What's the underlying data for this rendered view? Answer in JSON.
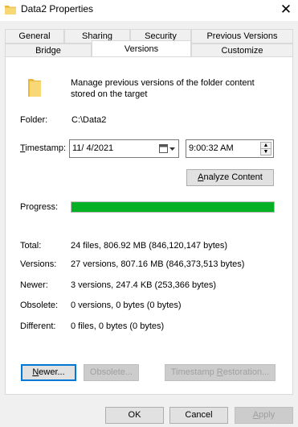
{
  "window": {
    "title": "Data2 Properties",
    "close_glyph": "✕"
  },
  "tabs_row_top": [
    {
      "label": "General"
    },
    {
      "label": "Sharing"
    },
    {
      "label": "Security"
    },
    {
      "label": "Previous Versions"
    }
  ],
  "tabs_row_bottom": [
    {
      "label": "Bridge"
    },
    {
      "label": "Versions",
      "active": true
    },
    {
      "label": "Customize"
    }
  ],
  "description": "Manage previous versions of the folder content stored on the target",
  "folder": {
    "label": "Folder:",
    "value": "C:\\Data2"
  },
  "timestamp": {
    "label_pre": "",
    "label_underline": "T",
    "label_post": "imestamp:",
    "date": "11/  4/2021",
    "time": "9:00:32 AM"
  },
  "analyze_button": {
    "underline": "A",
    "rest": "nalyze Content"
  },
  "progress": {
    "label": "Progress:",
    "fraction": 1.0
  },
  "stats": [
    {
      "label": "Total:",
      "value": "24 files, 806.92 MB (846,120,147 bytes)"
    },
    {
      "label": "Versions:",
      "value": "27 versions, 807.16 MB (846,373,513 bytes)"
    },
    {
      "label": "Newer:",
      "value": "3 versions, 247.4 KB (253,366 bytes)"
    },
    {
      "label": "Obsolete:",
      "value": "0 versions, 0 bytes (0 bytes)"
    },
    {
      "label": "Different:",
      "value": "0 files, 0 bytes (0 bytes)"
    }
  ],
  "actions": {
    "newer": {
      "underline": "N",
      "rest": "ewer..."
    },
    "obsolete": {
      "label": "Obsolete..."
    },
    "restore": {
      "pre": "Timestamp ",
      "underline": "R",
      "rest": "estoration..."
    }
  },
  "dialog_buttons": {
    "ok": "OK",
    "cancel": "Cancel",
    "apply_underline": "A",
    "apply_rest": "pply"
  },
  "colors": {
    "progress_fill": "#06b025",
    "accent": "#0078d7",
    "folder": "#f8d775"
  }
}
